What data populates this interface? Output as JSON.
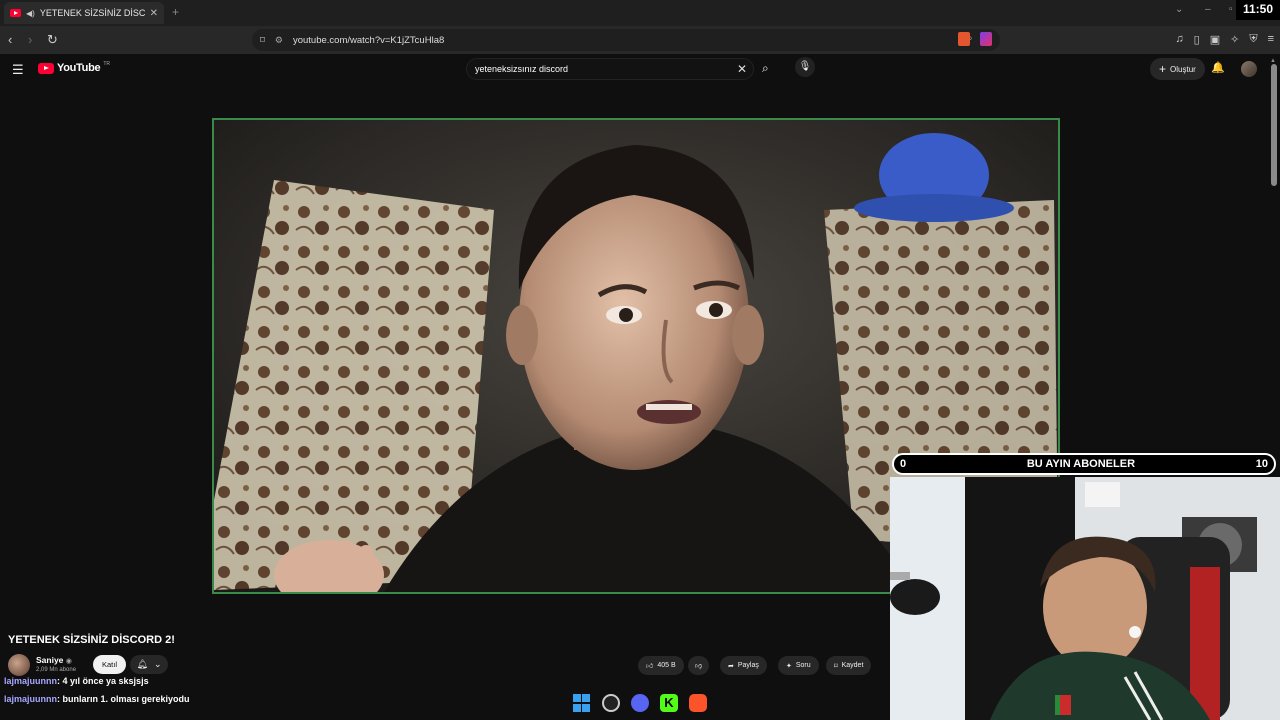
{
  "browser": {
    "tab_title": "YETENEK SİZSİNİZ DİSCORD",
    "tab_close": "✕",
    "new_tab": "+",
    "clock": "11:50",
    "url": "youtube.com/watch?v=K1jZTcuHla8"
  },
  "youtube": {
    "logo_text": "YouTube",
    "logo_region": "TR",
    "search_query": "yeteneksizsınız discord",
    "create_label": "Oluştur"
  },
  "video": {
    "title": "YETENEK SİZSİNİZ DİSCORD 2!",
    "channel_name": "Saniye",
    "channel_subs": "2,09 Mn abone",
    "join_label": "Katıl",
    "likes": "405 B",
    "share_label": "Paylaş",
    "ask_label": "Soru",
    "save_label": "Kaydet"
  },
  "chat": [
    {
      "user": "lajmajuunnn",
      "message": ": 4 yıl önce ya sksjsjs"
    },
    {
      "user": "lajmajuunnn",
      "message": ": bunların 1. olması gerekiyodu"
    }
  ],
  "overlay": {
    "sub_goal_title": "BU AYIN ABONELER",
    "sub_current": "0",
    "sub_target": "10"
  },
  "colors": {
    "youtube_red": "#ff0033",
    "video_border": "#3a8a4a",
    "chat_user": "#a6a6ff"
  },
  "icons": {
    "menu": "hamburger-icon",
    "search": "search-icon",
    "mic": "mic-icon",
    "bell": "bell-icon",
    "like": "thumbs-up-icon",
    "dislike": "thumbs-down-icon",
    "share": "share-icon",
    "save": "bookmark-icon"
  }
}
